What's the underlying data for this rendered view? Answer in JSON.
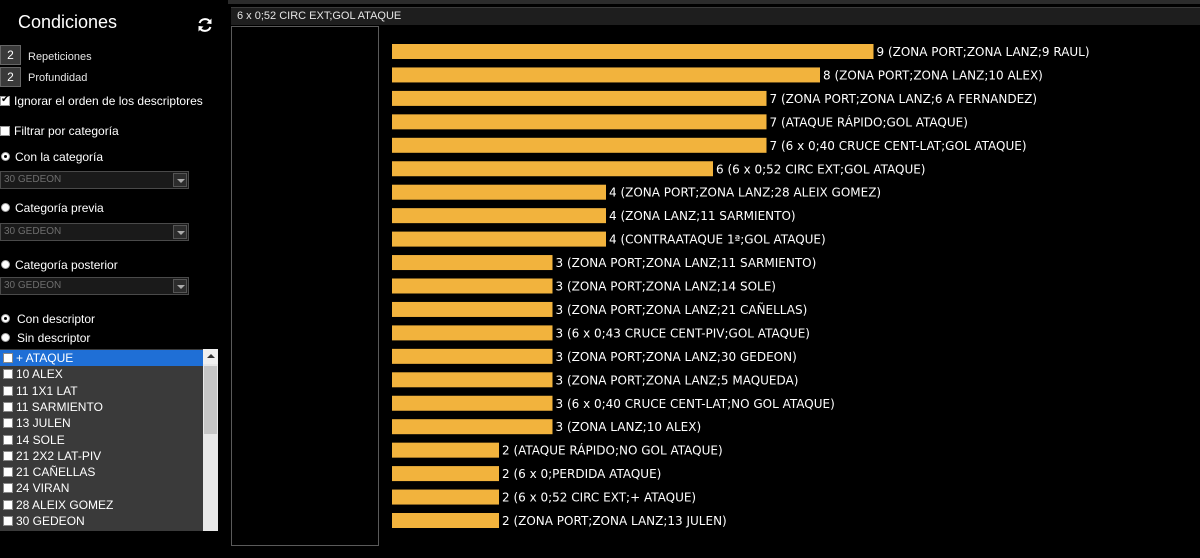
{
  "left_panel": {
    "title": "Condiciones",
    "repeticiones": {
      "value": "2",
      "label": "Repeticiones"
    },
    "profundidad": {
      "value": "2",
      "label": "Profundidad"
    },
    "ignorar_orden": {
      "label": "Ignorar el orden de los descriptores",
      "checked": true
    },
    "filtrar_categoria": {
      "label": "Filtrar por categoría",
      "checked": false
    },
    "con_categoria": {
      "label": "Con la categoría",
      "selected": "30 GEDEON"
    },
    "categoria_previa": {
      "label": "Categoría previa",
      "selected": "30 GEDEON"
    },
    "categoria_posterior": {
      "label": "Categoría posterior",
      "selected": "30 GEDEON"
    },
    "con_descriptor": "Con descriptor",
    "sin_descriptor": "Sin descriptor",
    "descriptors": [
      "+ ATAQUE",
      "10 ALEX",
      "11 1X1 LAT",
      "11 SARMIENTO",
      "13 JULEN",
      "14 SOLE",
      "21 2X2 LAT-PIV",
      "21 CAÑELLAS",
      "24 VIRAN",
      "28 ALEIX GOMEZ",
      "30 GEDEON"
    ]
  },
  "header": {
    "title": "6 x 0;52 CIRC EXT;GOL ATAQUE"
  },
  "colors": {
    "bar": "#f2b33d",
    "background": "#000000",
    "selected": "#1f6fd6"
  },
  "chart_data": {
    "type": "bar",
    "orientation": "horizontal",
    "categories": [
      "(ZONA PORT;ZONA LANZ;9 RAUL)",
      "(ZONA PORT;ZONA LANZ;10 ALEX)",
      "(ZONA PORT;ZONA LANZ;6 A FERNANDEZ)",
      "(ATAQUE RÁPIDO;GOL ATAQUE)",
      "(6 x 0;40 CRUCE CENT-LAT;GOL ATAQUE)",
      "(6 x 0;52 CIRC EXT;GOL ATAQUE)",
      "(ZONA PORT;ZONA LANZ;28 ALEIX GOMEZ)",
      "(ZONA LANZ;11 SARMIENTO)",
      "(CONTRAATAQUE 1ª;GOL ATAQUE)",
      "(ZONA PORT;ZONA LANZ;11 SARMIENTO)",
      "(ZONA PORT;ZONA LANZ;14 SOLE)",
      "(ZONA PORT;ZONA LANZ;21 CAÑELLAS)",
      "(6 x 0;43 CRUCE CENT-PIV;GOL ATAQUE)",
      "(ZONA PORT;ZONA LANZ;30 GEDEON)",
      "(ZONA PORT;ZONA LANZ;5 MAQUEDA)",
      "(6 x 0;40 CRUCE CENT-LAT;NO GOL ATAQUE)",
      "(ZONA LANZ;10 ALEX)",
      "(ATAQUE RÁPIDO;NO GOL ATAQUE)",
      "(6 x 0;PERDIDA ATAQUE)",
      "(6 x 0;52 CIRC EXT;+ ATAQUE)",
      "(ZONA PORT;ZONA LANZ;13 JULEN)"
    ],
    "values": [
      9,
      8,
      7,
      7,
      7,
      6,
      4,
      4,
      4,
      3,
      3,
      3,
      3,
      3,
      3,
      3,
      3,
      2,
      2,
      2,
      2
    ]
  }
}
